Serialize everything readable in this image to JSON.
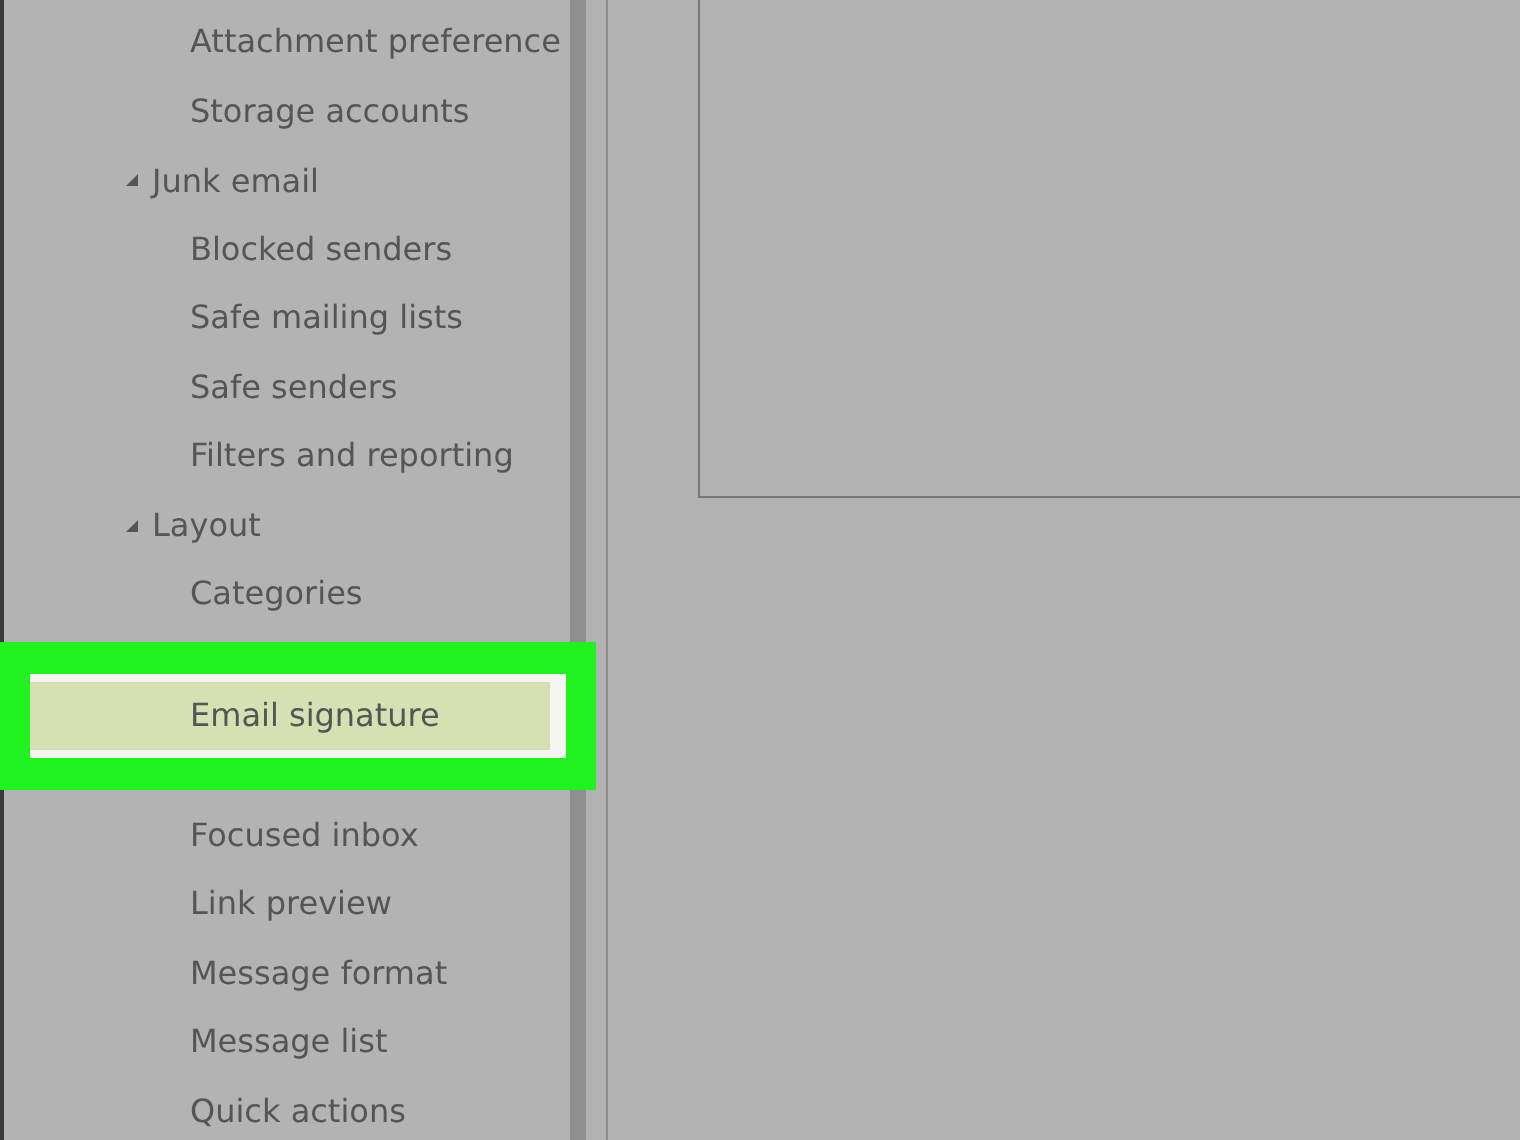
{
  "nav": {
    "items": [
      {
        "label": "Attachment preference",
        "selected": false
      },
      {
        "label": "Storage accounts",
        "selected": false
      },
      {
        "label": "Junk email",
        "expanded": true,
        "children": [
          {
            "label": "Blocked senders",
            "selected": false
          },
          {
            "label": "Safe mailing lists",
            "selected": false
          },
          {
            "label": "Safe senders",
            "selected": false
          },
          {
            "label": "Filters and reporting",
            "selected": false
          }
        ]
      },
      {
        "label": "Layout",
        "expanded": true,
        "children": [
          {
            "label": "Categories",
            "selected": false
          },
          {
            "label": "Email signature",
            "selected": true
          },
          {
            "label": "Focused inbox",
            "selected": false
          },
          {
            "label": "Link preview",
            "selected": false
          },
          {
            "label": "Message format",
            "selected": false
          },
          {
            "label": "Message list",
            "selected": false
          },
          {
            "label": "Quick actions",
            "selected": false
          }
        ]
      }
    ]
  }
}
